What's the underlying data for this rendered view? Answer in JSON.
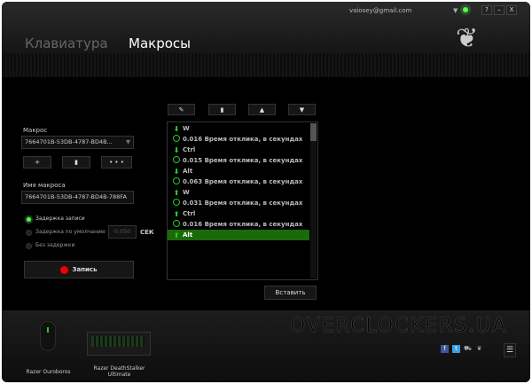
{
  "header": {
    "email": "vaiosey@gmail.com",
    "help": "?",
    "minimize": "–",
    "close": "X",
    "logo": "❦"
  },
  "tabs": [
    {
      "label": "Клавиатура"
    },
    {
      "label": "Макросы"
    }
  ],
  "left": {
    "macro_label": "Макрос",
    "macro_value": "7664701B-53DB-4787-BD4B...",
    "add": "+",
    "delete": "▮",
    "more": "• • •",
    "name_label": "Имя макроса",
    "name_value": "7664701B-53DB-4787-BD4B-788FA",
    "radios": [
      {
        "label": "Задержка записи",
        "checked": true
      },
      {
        "label": "Задержка по умолчанию",
        "checked": false
      },
      {
        "label": "Без задержки",
        "checked": false
      }
    ],
    "delay_value": "0.050",
    "delay_unit": "СЕК",
    "record": "Запись"
  },
  "toolbar": {
    "edit": "✎",
    "delete": "▮",
    "up": "▲",
    "down": "▼"
  },
  "list": [
    {
      "type": "down",
      "text": "W"
    },
    {
      "type": "delay",
      "text": "0.016 Время отклика, в секундах"
    },
    {
      "type": "down",
      "text": "Ctrl"
    },
    {
      "type": "delay",
      "text": "0.015 Время отклика, в секундах"
    },
    {
      "type": "down",
      "text": "Alt"
    },
    {
      "type": "delay",
      "text": "0.063 Время отклика, в секундах"
    },
    {
      "type": "up",
      "text": "W"
    },
    {
      "type": "delay",
      "text": "0.031 Время отклика, в секундах"
    },
    {
      "type": "up",
      "text": "Ctrl"
    },
    {
      "type": "delay",
      "text": "0.016 Время отклика, в секундах"
    },
    {
      "type": "up",
      "text": "Alt",
      "selected": true
    }
  ],
  "insert": "Вставить",
  "footer": {
    "watermark": "OVERCLOCKERS.UA",
    "devices": [
      {
        "name": "Razer Ouroboros"
      },
      {
        "name": "Razer DeathStalker Ultimate"
      }
    ],
    "menu": "☰"
  },
  "colors": {
    "accent": "#44ff22"
  }
}
